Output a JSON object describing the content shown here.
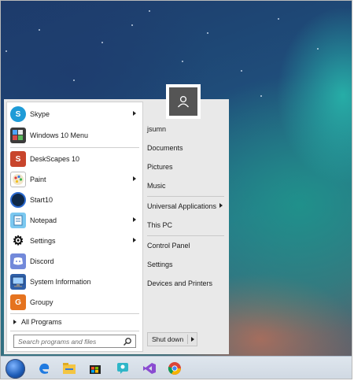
{
  "left_menu": {
    "items": [
      {
        "label": "Skype",
        "icon": "skype-icon",
        "has_arrow": true
      },
      {
        "label": "Windows 10 Menu",
        "icon": "windows10menu-icon",
        "has_arrow": false
      },
      {
        "label": "DeskScapes 10",
        "icon": "deskscapes-icon",
        "has_arrow": false
      },
      {
        "label": "Paint",
        "icon": "paint-icon",
        "has_arrow": true
      },
      {
        "label": "Start10",
        "icon": "start10-icon",
        "has_arrow": false
      },
      {
        "label": "Notepad",
        "icon": "notepad-icon",
        "has_arrow": true
      },
      {
        "label": "Settings",
        "icon": "gear-icon",
        "has_arrow": true
      },
      {
        "label": "Discord",
        "icon": "discord-icon",
        "has_arrow": false
      },
      {
        "label": "System Information",
        "icon": "system-information-icon",
        "has_arrow": false
      },
      {
        "label": "Groupy",
        "icon": "groupy-icon",
        "has_arrow": false
      }
    ],
    "all_programs": "All Programs",
    "search_placeholder": "Search programs and files"
  },
  "right_menu": {
    "user_icon": "user-icon",
    "items": [
      {
        "label": "jsumn",
        "has_arrow": false
      },
      {
        "label": "Documents",
        "has_arrow": false
      },
      {
        "label": "Pictures",
        "has_arrow": false
      },
      {
        "label": "Music",
        "has_arrow": false
      },
      {
        "label": "Universal Applications",
        "has_arrow": true
      },
      {
        "label": "This PC",
        "has_arrow": false
      },
      {
        "label": "Control Panel",
        "has_arrow": false
      },
      {
        "label": "Settings",
        "has_arrow": false
      },
      {
        "label": "Devices and Printers",
        "has_arrow": false
      }
    ],
    "shutdown_label": "Shut down"
  },
  "taskbar": {
    "icons": [
      "start-orb-icon",
      "edge-icon",
      "file-explorer-icon",
      "store-icon",
      "feedback-hub-icon",
      "visual-studio-icon",
      "chrome-icon"
    ]
  },
  "colors": {
    "menu_bg": "#e9e9e9",
    "pane_bg": "#ffffff",
    "user_tile": "#555555"
  }
}
